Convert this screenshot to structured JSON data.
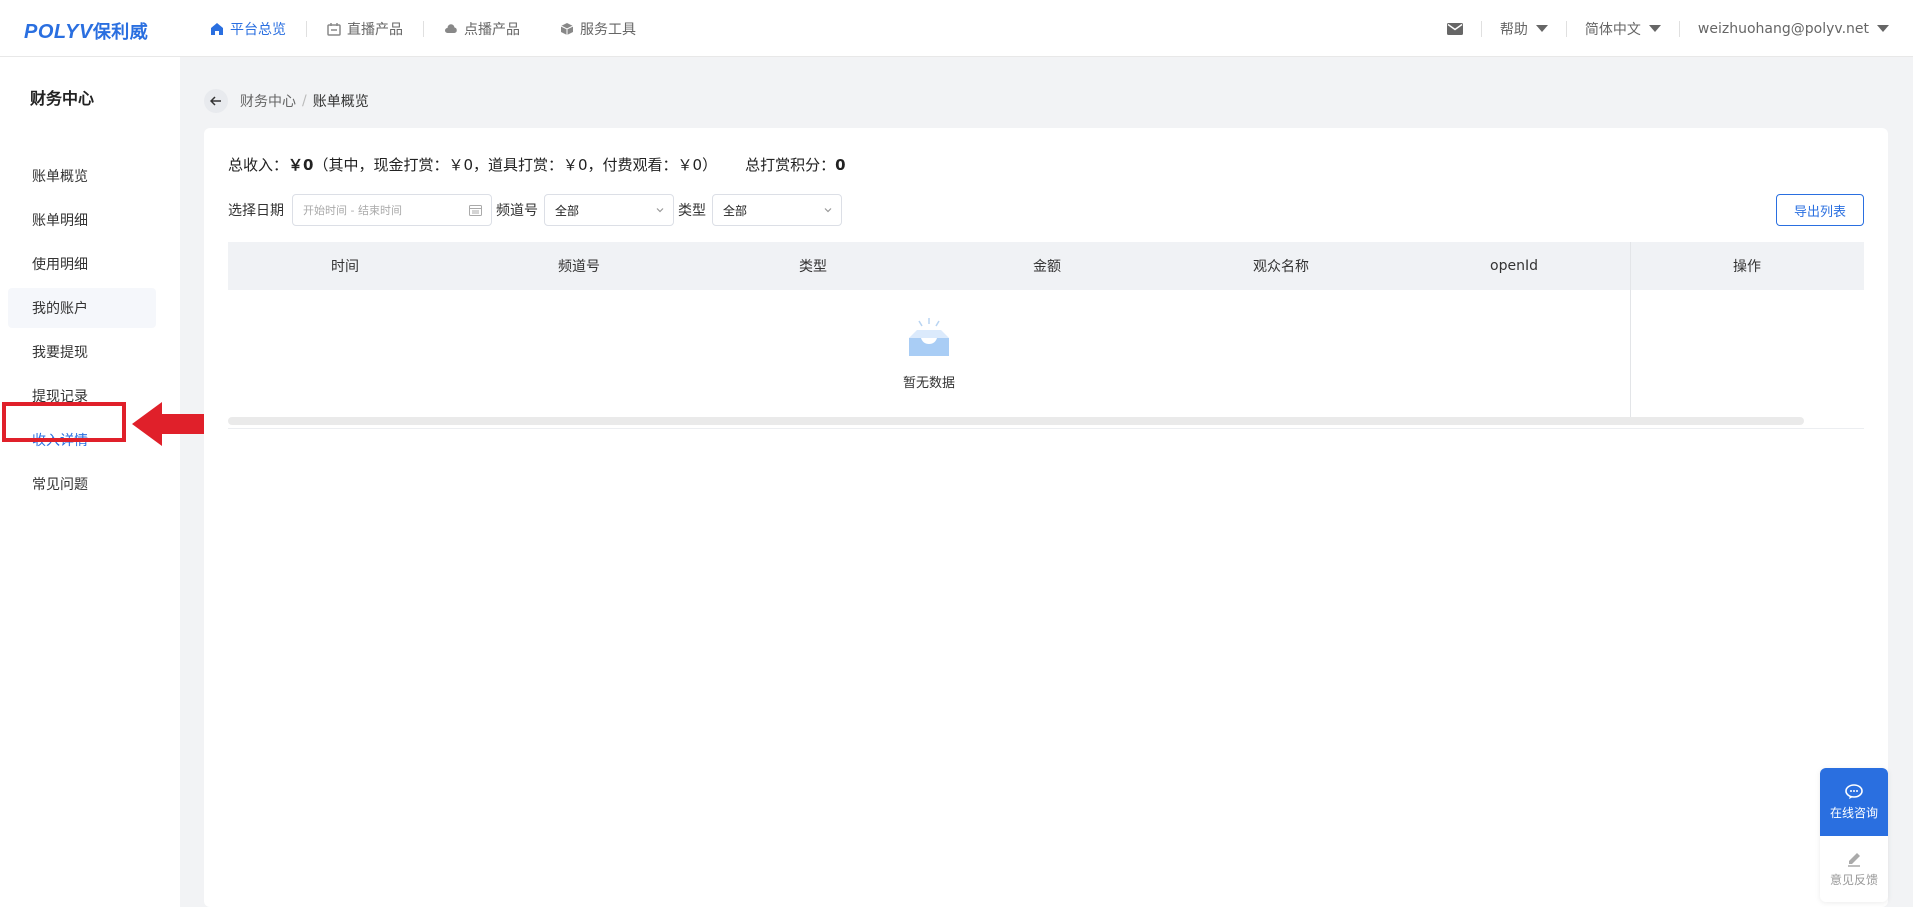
{
  "brand": {
    "logo_text": "POLYV",
    "logo_cn": "保利威",
    "color": "#2a6fe0"
  },
  "nav": {
    "items": [
      {
        "label": "平台总览",
        "icon": "home-icon"
      },
      {
        "label": "直播产品",
        "icon": "live-icon"
      },
      {
        "label": "点播产品",
        "icon": "cloud-icon"
      },
      {
        "label": "服务工具",
        "icon": "box-icon"
      }
    ]
  },
  "header_right": {
    "mail_icon": "mail-icon",
    "help": "帮助",
    "language": "简体中文",
    "account": "weizhuohang@polyv.net"
  },
  "sidebar": {
    "title": "财务中心",
    "items": [
      {
        "label": "账单概览"
      },
      {
        "label": "账单明细"
      },
      {
        "label": "使用明细"
      },
      {
        "label": "我的账户"
      },
      {
        "label": "我要提现"
      },
      {
        "label": "提现记录"
      },
      {
        "label": "收入详情"
      },
      {
        "label": "常见问题"
      }
    ]
  },
  "breadcrumb": {
    "parent": "财务中心",
    "separator": "/",
    "current": "账单概览"
  },
  "summary": {
    "total_label": "总收入：",
    "total_value": "￥0",
    "detail": "（其中，现金打赏：￥0，道具打赏：￥0，付费观看：￥0）",
    "points_label": "总打赏积分：",
    "points_value": "0"
  },
  "filters": {
    "date_label": "选择日期",
    "date_placeholder": "开始时间 - 结束时间",
    "channel_label": "频道号",
    "channel_value": "全部",
    "type_label": "类型",
    "type_value": "全部",
    "export_label": "导出列表"
  },
  "table": {
    "columns": [
      "时间",
      "频道号",
      "类型",
      "金额",
      "观众名称",
      "openId",
      "操作"
    ],
    "empty_text": "暂无数据"
  },
  "float": {
    "consult": "在线咨询",
    "feedback": "意见反馈"
  },
  "colors": {
    "accent": "#2a6fe0",
    "highlight": "#e0202a",
    "page_bg": "#f2f3f5"
  }
}
